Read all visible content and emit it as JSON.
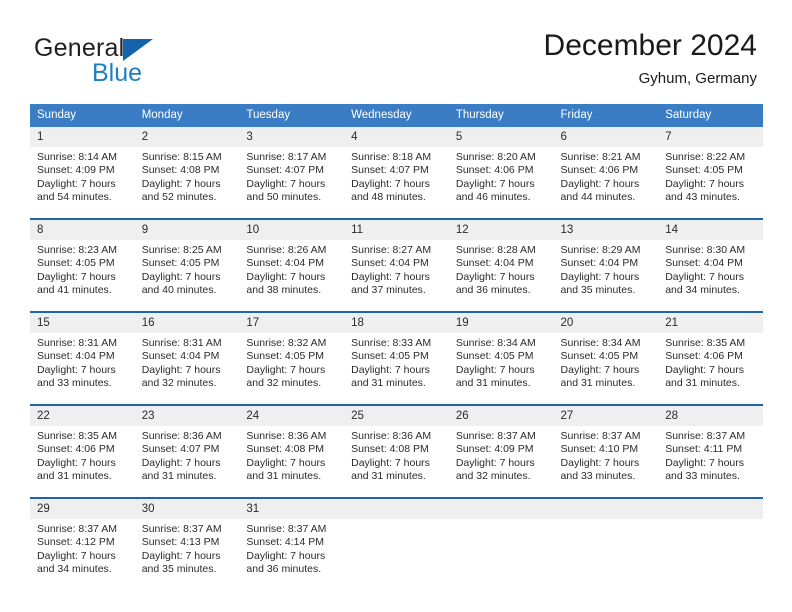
{
  "brand": {
    "name_part1": "General",
    "name_part2": "Blue",
    "triangle_color": "#1464ab",
    "blue_color": "#1e7fc4"
  },
  "header": {
    "title": "December 2024",
    "subtitle": "Gyhum, Germany"
  },
  "theme": {
    "header_blue": "#3b7dc4",
    "week_divider": "#1f63a8",
    "daynum_band": "#efefef"
  },
  "weekdays": [
    "Sunday",
    "Monday",
    "Tuesday",
    "Wednesday",
    "Thursday",
    "Friday",
    "Saturday"
  ],
  "weeks": [
    {
      "days": [
        {
          "num": "1",
          "sunrise": "Sunrise: 8:14 AM",
          "sunset": "Sunset: 4:09 PM",
          "daylight1": "Daylight: 7 hours",
          "daylight2": "and 54 minutes."
        },
        {
          "num": "2",
          "sunrise": "Sunrise: 8:15 AM",
          "sunset": "Sunset: 4:08 PM",
          "daylight1": "Daylight: 7 hours",
          "daylight2": "and 52 minutes."
        },
        {
          "num": "3",
          "sunrise": "Sunrise: 8:17 AM",
          "sunset": "Sunset: 4:07 PM",
          "daylight1": "Daylight: 7 hours",
          "daylight2": "and 50 minutes."
        },
        {
          "num": "4",
          "sunrise": "Sunrise: 8:18 AM",
          "sunset": "Sunset: 4:07 PM",
          "daylight1": "Daylight: 7 hours",
          "daylight2": "and 48 minutes."
        },
        {
          "num": "5",
          "sunrise": "Sunrise: 8:20 AM",
          "sunset": "Sunset: 4:06 PM",
          "daylight1": "Daylight: 7 hours",
          "daylight2": "and 46 minutes."
        },
        {
          "num": "6",
          "sunrise": "Sunrise: 8:21 AM",
          "sunset": "Sunset: 4:06 PM",
          "daylight1": "Daylight: 7 hours",
          "daylight2": "and 44 minutes."
        },
        {
          "num": "7",
          "sunrise": "Sunrise: 8:22 AM",
          "sunset": "Sunset: 4:05 PM",
          "daylight1": "Daylight: 7 hours",
          "daylight2": "and 43 minutes."
        }
      ]
    },
    {
      "days": [
        {
          "num": "8",
          "sunrise": "Sunrise: 8:23 AM",
          "sunset": "Sunset: 4:05 PM",
          "daylight1": "Daylight: 7 hours",
          "daylight2": "and 41 minutes."
        },
        {
          "num": "9",
          "sunrise": "Sunrise: 8:25 AM",
          "sunset": "Sunset: 4:05 PM",
          "daylight1": "Daylight: 7 hours",
          "daylight2": "and 40 minutes."
        },
        {
          "num": "10",
          "sunrise": "Sunrise: 8:26 AM",
          "sunset": "Sunset: 4:04 PM",
          "daylight1": "Daylight: 7 hours",
          "daylight2": "and 38 minutes."
        },
        {
          "num": "11",
          "sunrise": "Sunrise: 8:27 AM",
          "sunset": "Sunset: 4:04 PM",
          "daylight1": "Daylight: 7 hours",
          "daylight2": "and 37 minutes."
        },
        {
          "num": "12",
          "sunrise": "Sunrise: 8:28 AM",
          "sunset": "Sunset: 4:04 PM",
          "daylight1": "Daylight: 7 hours",
          "daylight2": "and 36 minutes."
        },
        {
          "num": "13",
          "sunrise": "Sunrise: 8:29 AM",
          "sunset": "Sunset: 4:04 PM",
          "daylight1": "Daylight: 7 hours",
          "daylight2": "and 35 minutes."
        },
        {
          "num": "14",
          "sunrise": "Sunrise: 8:30 AM",
          "sunset": "Sunset: 4:04 PM",
          "daylight1": "Daylight: 7 hours",
          "daylight2": "and 34 minutes."
        }
      ]
    },
    {
      "days": [
        {
          "num": "15",
          "sunrise": "Sunrise: 8:31 AM",
          "sunset": "Sunset: 4:04 PM",
          "daylight1": "Daylight: 7 hours",
          "daylight2": "and 33 minutes."
        },
        {
          "num": "16",
          "sunrise": "Sunrise: 8:31 AM",
          "sunset": "Sunset: 4:04 PM",
          "daylight1": "Daylight: 7 hours",
          "daylight2": "and 32 minutes."
        },
        {
          "num": "17",
          "sunrise": "Sunrise: 8:32 AM",
          "sunset": "Sunset: 4:05 PM",
          "daylight1": "Daylight: 7 hours",
          "daylight2": "and 32 minutes."
        },
        {
          "num": "18",
          "sunrise": "Sunrise: 8:33 AM",
          "sunset": "Sunset: 4:05 PM",
          "daylight1": "Daylight: 7 hours",
          "daylight2": "and 31 minutes."
        },
        {
          "num": "19",
          "sunrise": "Sunrise: 8:34 AM",
          "sunset": "Sunset: 4:05 PM",
          "daylight1": "Daylight: 7 hours",
          "daylight2": "and 31 minutes."
        },
        {
          "num": "20",
          "sunrise": "Sunrise: 8:34 AM",
          "sunset": "Sunset: 4:05 PM",
          "daylight1": "Daylight: 7 hours",
          "daylight2": "and 31 minutes."
        },
        {
          "num": "21",
          "sunrise": "Sunrise: 8:35 AM",
          "sunset": "Sunset: 4:06 PM",
          "daylight1": "Daylight: 7 hours",
          "daylight2": "and 31 minutes."
        }
      ]
    },
    {
      "days": [
        {
          "num": "22",
          "sunrise": "Sunrise: 8:35 AM",
          "sunset": "Sunset: 4:06 PM",
          "daylight1": "Daylight: 7 hours",
          "daylight2": "and 31 minutes."
        },
        {
          "num": "23",
          "sunrise": "Sunrise: 8:36 AM",
          "sunset": "Sunset: 4:07 PM",
          "daylight1": "Daylight: 7 hours",
          "daylight2": "and 31 minutes."
        },
        {
          "num": "24",
          "sunrise": "Sunrise: 8:36 AM",
          "sunset": "Sunset: 4:08 PM",
          "daylight1": "Daylight: 7 hours",
          "daylight2": "and 31 minutes."
        },
        {
          "num": "25",
          "sunrise": "Sunrise: 8:36 AM",
          "sunset": "Sunset: 4:08 PM",
          "daylight1": "Daylight: 7 hours",
          "daylight2": "and 31 minutes."
        },
        {
          "num": "26",
          "sunrise": "Sunrise: 8:37 AM",
          "sunset": "Sunset: 4:09 PM",
          "daylight1": "Daylight: 7 hours",
          "daylight2": "and 32 minutes."
        },
        {
          "num": "27",
          "sunrise": "Sunrise: 8:37 AM",
          "sunset": "Sunset: 4:10 PM",
          "daylight1": "Daylight: 7 hours",
          "daylight2": "and 33 minutes."
        },
        {
          "num": "28",
          "sunrise": "Sunrise: 8:37 AM",
          "sunset": "Sunset: 4:11 PM",
          "daylight1": "Daylight: 7 hours",
          "daylight2": "and 33 minutes."
        }
      ]
    },
    {
      "days": [
        {
          "num": "29",
          "sunrise": "Sunrise: 8:37 AM",
          "sunset": "Sunset: 4:12 PM",
          "daylight1": "Daylight: 7 hours",
          "daylight2": "and 34 minutes."
        },
        {
          "num": "30",
          "sunrise": "Sunrise: 8:37 AM",
          "sunset": "Sunset: 4:13 PM",
          "daylight1": "Daylight: 7 hours",
          "daylight2": "and 35 minutes."
        },
        {
          "num": "31",
          "sunrise": "Sunrise: 8:37 AM",
          "sunset": "Sunset: 4:14 PM",
          "daylight1": "Daylight: 7 hours",
          "daylight2": "and 36 minutes."
        },
        {
          "num": "",
          "sunrise": "",
          "sunset": "",
          "daylight1": "",
          "daylight2": ""
        },
        {
          "num": "",
          "sunrise": "",
          "sunset": "",
          "daylight1": "",
          "daylight2": ""
        },
        {
          "num": "",
          "sunrise": "",
          "sunset": "",
          "daylight1": "",
          "daylight2": ""
        },
        {
          "num": "",
          "sunrise": "",
          "sunset": "",
          "daylight1": "",
          "daylight2": ""
        }
      ]
    }
  ]
}
